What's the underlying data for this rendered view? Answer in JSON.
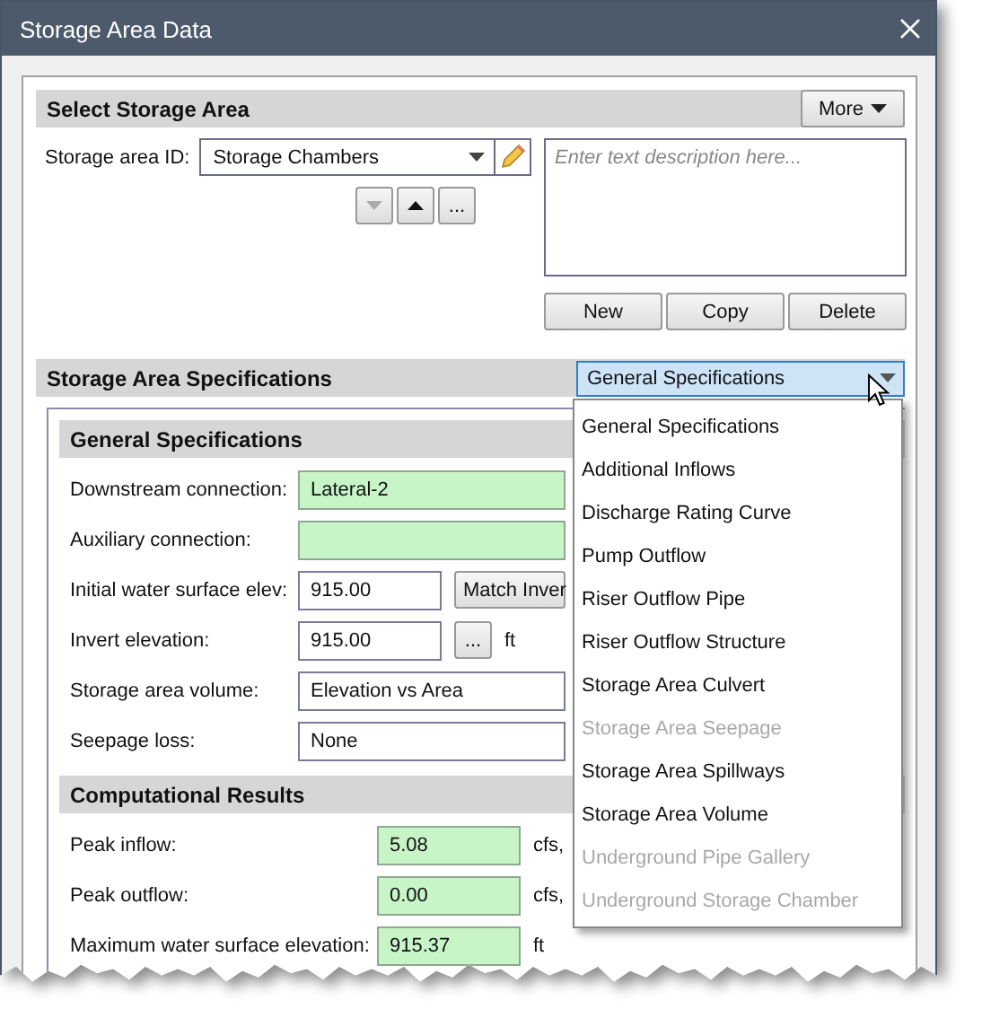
{
  "window": {
    "title": "Storage Area Data"
  },
  "select_storage_area": {
    "title": "Select Storage Area",
    "more_button": "More",
    "id_label": "Storage area ID:",
    "id_value": "Storage Chambers",
    "nav_buttons": [
      {
        "kind": "down",
        "disabled": true
      },
      {
        "kind": "up",
        "disabled": false
      },
      {
        "kind": "ellipsis",
        "label": "...",
        "disabled": false
      }
    ],
    "description": {
      "placeholder": "Enter text description here..."
    },
    "buttons": [
      "New",
      "Copy",
      "Delete"
    ]
  },
  "specifications": {
    "title": "Storage Area Specifications",
    "dropdown": {
      "value": "General Specifications",
      "expanded": true,
      "options": [
        {
          "label": "General Specifications",
          "disabled": false
        },
        {
          "label": "Additional Inflows",
          "disabled": false
        },
        {
          "label": "Discharge Rating Curve",
          "disabled": false
        },
        {
          "label": "Pump Outflow",
          "disabled": false
        },
        {
          "label": "Riser Outflow Pipe",
          "disabled": false
        },
        {
          "label": "Riser Outflow Structure",
          "disabled": false
        },
        {
          "label": "Storage Area Culvert",
          "disabled": false
        },
        {
          "label": "Storage Area Seepage",
          "disabled": true
        },
        {
          "label": "Storage Area Spillways",
          "disabled": false
        },
        {
          "label": "Storage Area Volume",
          "disabled": false
        },
        {
          "label": "Underground Pipe Gallery",
          "disabled": true
        },
        {
          "label": "Underground Storage Chamber",
          "disabled": true
        }
      ]
    }
  },
  "general": {
    "title": "General Specifications",
    "rows": [
      {
        "kind": "picker",
        "label": "Downstream connection:",
        "value": "Lateral-2"
      },
      {
        "kind": "picker",
        "label": "Auxiliary connection:"
      },
      {
        "kind": "input_button",
        "label": "Initial water surface elev:",
        "value": "915.00",
        "button": "Match Inver"
      },
      {
        "kind": "input_unit",
        "label": "Invert elevation:",
        "value": "915.00",
        "button": "...",
        "unit": "ft"
      },
      {
        "kind": "select",
        "label": "Storage area volume:",
        "value": "Elevation vs Area"
      },
      {
        "kind": "select",
        "label": "Seepage loss:",
        "value": "None"
      }
    ]
  },
  "results": {
    "title": "Computational Results",
    "rows": [
      {
        "label": "Peak inflow:",
        "value": "5.08",
        "unit": "cfs,"
      },
      {
        "label": "Peak outflow:",
        "value": "0.00",
        "unit": "cfs,"
      },
      {
        "label": "Maximum water surface elevation:",
        "value": "915.37",
        "unit": "ft"
      }
    ]
  }
}
